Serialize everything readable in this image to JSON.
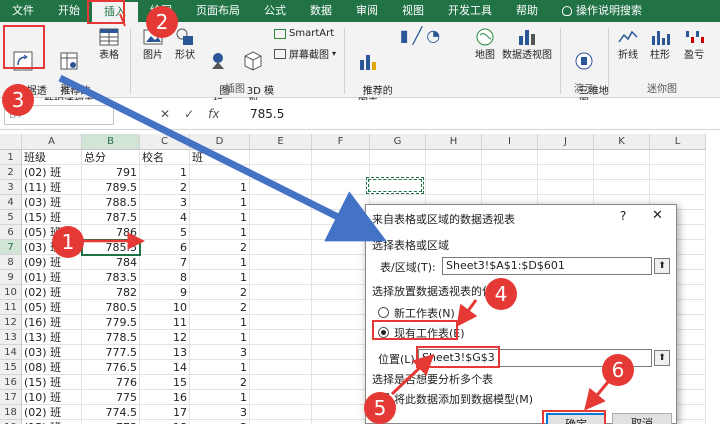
{
  "ribbon_tabs": [
    "文件",
    "开始",
    "插入",
    "绘图",
    "页面布局",
    "公式",
    "数据",
    "审阅",
    "视图",
    "开发工具",
    "帮助"
  ],
  "tell_me": "操作说明搜索",
  "ribbon": {
    "pivot_table": "数据透\n视表",
    "recommended_pivot": "推荐的\n数据透视表",
    "table": "表格",
    "tables_group": "表格",
    "pictures": "图片",
    "shapes": "形状",
    "icons": "图\n标",
    "models_3d": "3D 模\n型",
    "smartart": "SmartArt",
    "screenshot": "屏幕截图",
    "illustrations_group": "插图",
    "recommended_charts": "推荐的\n图表",
    "maps": "地图",
    "pivot_chart": "数据透视图",
    "charts_group": "",
    "map_3d": "三维地\n图",
    "tours_group": "演示",
    "line": "折线",
    "column": "柱形",
    "winloss": "盈亏",
    "sparklines_group": "迷你图"
  },
  "formula_bar": {
    "name_box": "B7",
    "value": "785.5"
  },
  "columns": [
    "A",
    "B",
    "C",
    "D",
    "E",
    "F",
    "G",
    "H",
    "I",
    "J",
    "K",
    "L"
  ],
  "rows": [
    [
      "班级",
      "总分",
      "校名",
      "班"
    ],
    [
      "(02) 班",
      "791",
      "1",
      ""
    ],
    [
      "(11) 班",
      "789.5",
      "2",
      "1"
    ],
    [
      "(03) 班",
      "788.5",
      "3",
      "1"
    ],
    [
      "(15) 班",
      "787.5",
      "4",
      "1"
    ],
    [
      "(05) 班",
      "786",
      "5",
      "1"
    ],
    [
      "(03) 班",
      "785.5",
      "6",
      "2"
    ],
    [
      "(09) 班",
      "784",
      "7",
      "1"
    ],
    [
      "(01) 班",
      "783.5",
      "8",
      "1"
    ],
    [
      "(02) 班",
      "782",
      "9",
      "2"
    ],
    [
      "(05) 班",
      "780.5",
      "10",
      "2"
    ],
    [
      "(16) 班",
      "779.5",
      "11",
      "1"
    ],
    [
      "(13) 班",
      "778.5",
      "12",
      "1"
    ],
    [
      "(03) 班",
      "777.5",
      "13",
      "3"
    ],
    [
      "(08) 班",
      "776.5",
      "14",
      "1"
    ],
    [
      "(15) 班",
      "776",
      "15",
      "2"
    ],
    [
      "(10) 班",
      "775",
      "16",
      "1"
    ],
    [
      "(02) 班",
      "774.5",
      "17",
      "3"
    ],
    [
      "(15) 班",
      "773",
      "18",
      "3"
    ]
  ],
  "dialog": {
    "title": "来自表格或区域的数据透视表",
    "help": "?",
    "close": "✕",
    "section_range": "选择表格或区域",
    "range_label": "表/区域(T):",
    "range_value": "Sheet3!$A$1:$D$601",
    "section_location": "选择放置数据透视表的位置",
    "new_sheet": "新工作表(N)",
    "existing_sheet": "现有工作表(E)",
    "location_label": "位置(L):",
    "location_value": "Sheet3!$G$3",
    "section_multi": "选择是否想要分析多个表",
    "add_model": "将此数据添加到数据模型(M)",
    "ok": "确定",
    "cancel": "取消"
  },
  "annotations": [
    "1",
    "2",
    "3",
    "4",
    "5",
    "6"
  ],
  "colors": {
    "excel_green": "#217346",
    "annotation_red": "#e53935",
    "arrow_blue": "#4472c4"
  }
}
